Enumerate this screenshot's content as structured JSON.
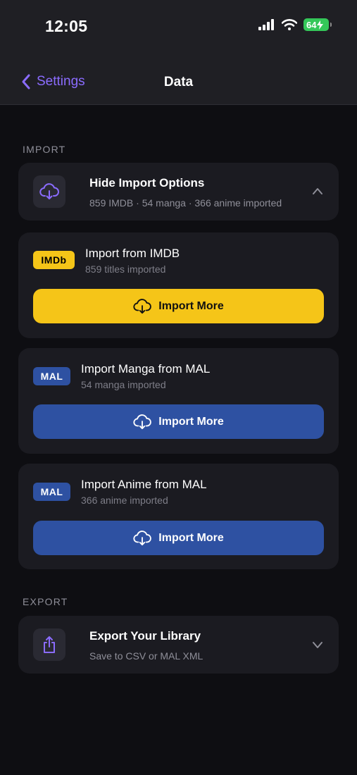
{
  "status_bar": {
    "time": "12:05",
    "battery": "64"
  },
  "nav": {
    "back_label": "Settings",
    "title": "Data"
  },
  "import_section": {
    "label": "IMPORT",
    "toggle": {
      "title": "Hide Import Options",
      "subtitle": "859 IMDB · 54 manga · 366 anime imported"
    },
    "sources": [
      {
        "badge": "IMDb",
        "title": "Import from IMDB",
        "subtitle": "859 titles imported",
        "button": "Import More",
        "badge_bg": "#f5c518",
        "badge_fg": "#000000",
        "button_bg": "#f5c518",
        "button_fg": "#111111"
      },
      {
        "badge": "MAL",
        "title": "Import Manga from MAL",
        "subtitle": "54 manga imported",
        "button": "Import More",
        "badge_bg": "#2e51a2",
        "badge_fg": "#ffffff",
        "button_bg": "#2e51a2",
        "button_fg": "#ffffff"
      },
      {
        "badge": "MAL",
        "title": "Import Anime from MAL",
        "subtitle": "366 anime imported",
        "button": "Import More",
        "badge_bg": "#2e51a2",
        "badge_fg": "#ffffff",
        "button_bg": "#2e51a2",
        "button_fg": "#ffffff"
      }
    ]
  },
  "export_section": {
    "label": "EXPORT",
    "toggle": {
      "title": "Export Your Library",
      "subtitle": "Save to CSV or MAL XML"
    }
  },
  "colors": {
    "accent": "#8b6cff",
    "background": "#0e0e12",
    "card": "#1b1b21"
  },
  "icons": {
    "import_toggle": "cloud-download-icon",
    "export_toggle": "share-icon",
    "collapse": "chevron-up-icon",
    "expand": "chevron-down-icon",
    "button": "cloud-download-icon"
  }
}
